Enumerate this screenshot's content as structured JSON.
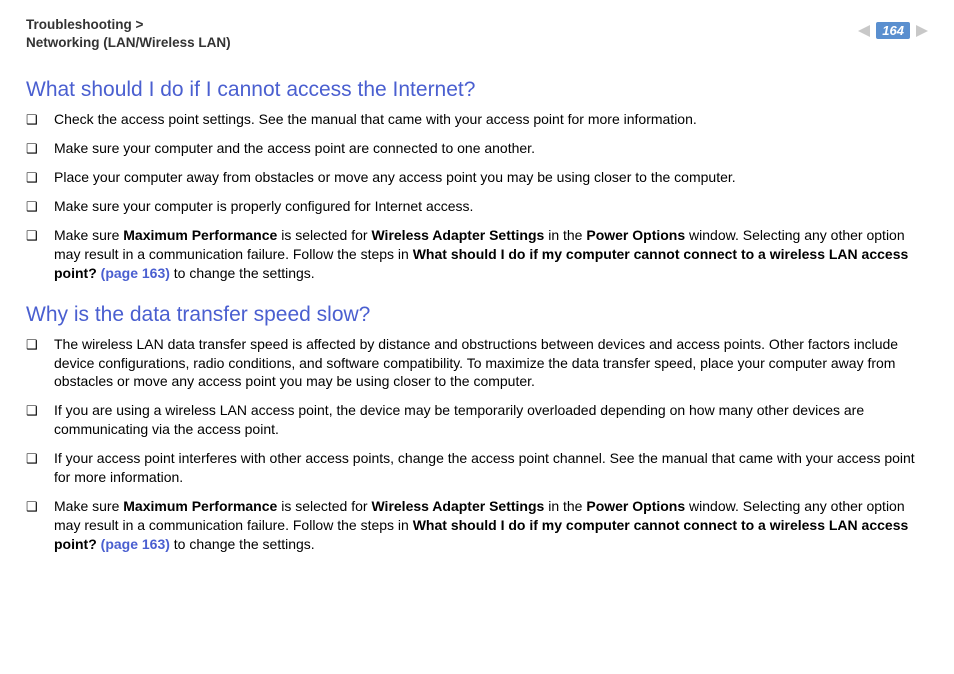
{
  "header": {
    "breadcrumb_top": "Troubleshooting >",
    "breadcrumb_bottom": "Networking (LAN/Wireless LAN)",
    "page_number": "164"
  },
  "section1": {
    "title": "What should I do if I cannot access the Internet?",
    "i1": "Check the access point settings. See the manual that came with your access point for more information.",
    "i2": "Make sure your computer and the access point are connected to one another.",
    "i3": "Place your computer away from obstacles or move any access point you may be using closer to the computer.",
    "i4": "Make sure your computer is properly configured for Internet access.",
    "i5_pre": "Make sure ",
    "i5_b1": "Maximum Performance",
    "i5_mid1": " is selected for ",
    "i5_b2": "Wireless Adapter Settings",
    "i5_mid2": " in the ",
    "i5_b3": "Power Options",
    "i5_mid3": " window. Selecting any other option may result in a communication failure. Follow the steps in ",
    "i5_b4": "What should I do if my computer cannot connect to a wireless LAN access point? ",
    "i5_link": "(page 163)",
    "i5_end": " to change the settings."
  },
  "section2": {
    "title": "Why is the data transfer speed slow?",
    "i1": "The wireless LAN data transfer speed is affected by distance and obstructions between devices and access points. Other factors include device configurations, radio conditions, and software compatibility. To maximize the data transfer speed, place your computer away from obstacles or move any access point you may be using closer to the computer.",
    "i2": "If you are using a wireless LAN access point, the device may be temporarily overloaded depending on how many other devices are communicating via the access point.",
    "i3": "If your access point interferes with other access points, change the access point channel. See the manual that came with your access point for more information.",
    "i4_pre": "Make sure ",
    "i4_b1": "Maximum Performance",
    "i4_mid1": " is selected for ",
    "i4_b2": "Wireless Adapter Settings",
    "i4_mid2": " in the ",
    "i4_b3": "Power Options",
    "i4_mid3": " window. Selecting any other option may result in a communication failure. Follow the steps in ",
    "i4_b4": "What should I do if my computer cannot connect to a wireless LAN access point? ",
    "i4_link": "(page 163)",
    "i4_end": " to change the settings."
  }
}
